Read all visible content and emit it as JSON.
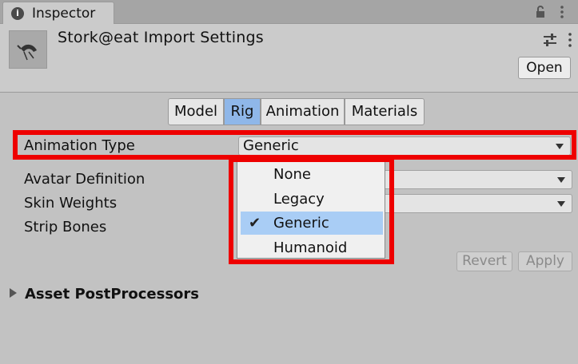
{
  "window": {
    "tab_label": "Inspector",
    "icons": [
      "info-icon",
      "lock-icon",
      "more-menu-icon"
    ]
  },
  "header": {
    "title": "Stork@eat Import Settings",
    "open_label": "Open",
    "icons": [
      "asset-thumbnail",
      "preset-sliders-icon",
      "more-menu-icon"
    ]
  },
  "tabs": [
    {
      "label": "Model",
      "active": false
    },
    {
      "label": "Rig",
      "active": true
    },
    {
      "label": "Animation",
      "active": false
    },
    {
      "label": "Materials",
      "active": false
    }
  ],
  "properties": {
    "animation_type": {
      "label": "Animation Type",
      "value": "Generic"
    },
    "avatar_definition": {
      "label": "Avatar Definition"
    },
    "skin_weights": {
      "label": "Skin Weights"
    },
    "strip_bones": {
      "label": "Strip Bones"
    }
  },
  "popup": {
    "options": [
      {
        "label": "None",
        "selected": false
      },
      {
        "label": "Legacy",
        "selected": false
      },
      {
        "label": "Generic",
        "selected": true
      },
      {
        "label": "Humanoid",
        "selected": false
      }
    ],
    "check_glyph": "✔"
  },
  "actions": {
    "revert_label": "Revert",
    "apply_label": "Apply"
  },
  "foldout": {
    "label": "Asset PostProcessors"
  },
  "colors": {
    "highlight": "#ee0000",
    "active_tab": "#8fb7e9",
    "selected_option": "#a9cdf5"
  }
}
